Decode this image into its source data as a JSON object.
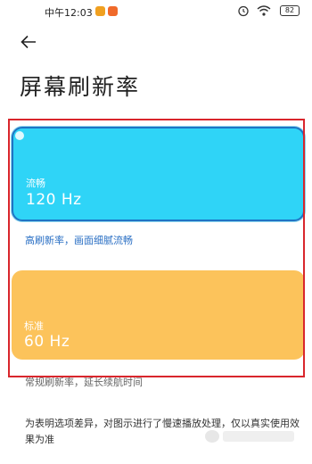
{
  "status_bar": {
    "time": "中午12:03",
    "battery": "82",
    "icons": [
      "notification-app-icon",
      "notification-app-icon",
      "alarm-icon",
      "wifi-icon",
      "battery-icon"
    ]
  },
  "header": {
    "back_icon": "back-arrow-icon",
    "title": "屏幕刷新率"
  },
  "options": [
    {
      "name": "流畅",
      "rate": "120 Hz",
      "description": "高刷新率，画面细腻流畅",
      "selected": true,
      "color": "#2fd4f7"
    },
    {
      "name": "标准",
      "rate": "60 Hz",
      "description": "常规刷新率，延长续航时间",
      "selected": false,
      "color": "#fcc35b"
    }
  ],
  "footnote": "为表明选项差异，对图示进行了慢速播放处理，仅以真实使用效果为准",
  "colors": {
    "highlight_frame": "#d9262c",
    "selected_border": "#1f74c4",
    "selected_desc_text": "#2a6fc4"
  }
}
